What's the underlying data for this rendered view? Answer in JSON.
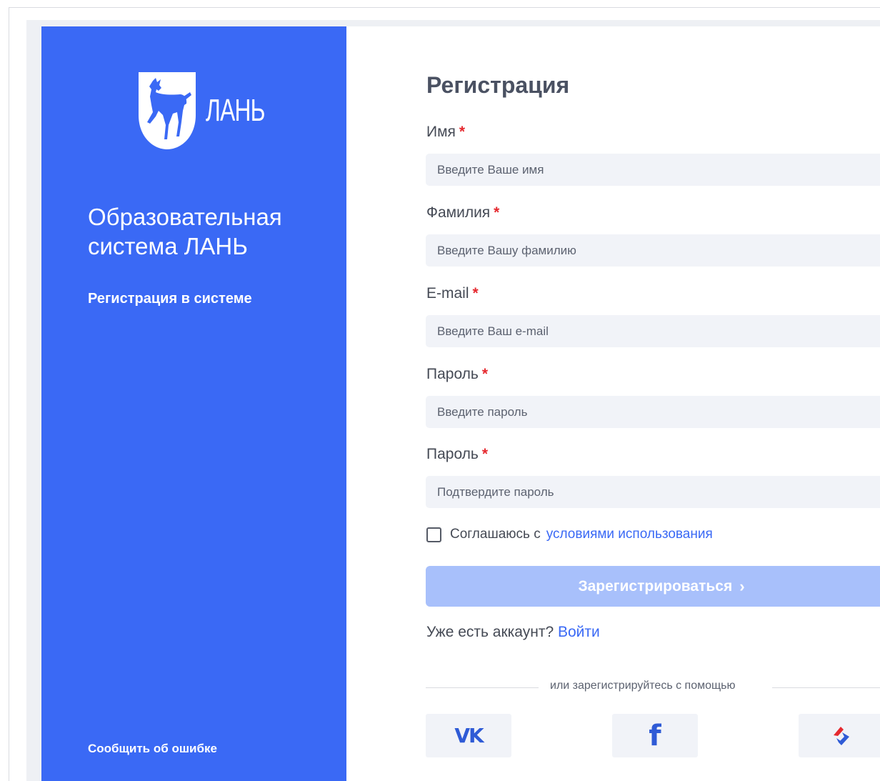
{
  "brand": {
    "logo_text": "ЛАНЬ",
    "title": "Образовательная система ЛАНЬ",
    "subtitle": "Регистрация в системе",
    "report_link": "Сообщить об ошибке",
    "colors": {
      "primary": "#3a69f5",
      "button_disabled": "#a8c0fb",
      "required": "#e5292f",
      "input_bg": "#f1f3f8"
    },
    "logo_icon": "deer-shield-icon"
  },
  "form": {
    "title": "Регистрация",
    "fields": [
      {
        "label": "Имя",
        "required_mark": "*",
        "placeholder": "Введите Ваше имя",
        "value": ""
      },
      {
        "label": "Фамилия",
        "required_mark": "*",
        "placeholder": "Введите Вашу фамилию",
        "value": ""
      },
      {
        "label": "E-mail",
        "required_mark": "*",
        "placeholder": "Введите Ваш e-mail",
        "value": ""
      },
      {
        "label": "Пароль",
        "required_mark": "*",
        "placeholder": "Введите пароль",
        "value": ""
      },
      {
        "label": "Пароль",
        "required_mark": "*",
        "placeholder": "Подтвердите пароль",
        "value": ""
      }
    ],
    "agree_text": "Соглашаюсь с",
    "terms_link": "условиями использования",
    "agree_checked": false,
    "submit_label": "Зарегистрироваться",
    "submit_chevron": "›",
    "have_account_text": "Уже есть аккаунт?",
    "login_link": "Войти",
    "social_divider_text": "или зарегистрируйтесь с помощью",
    "social": [
      {
        "name": "vk",
        "glyph": "VK",
        "icon": "vk-icon"
      },
      {
        "name": "facebook",
        "glyph": "f",
        "icon": "facebook-icon"
      },
      {
        "name": "gosuslugi",
        "icon": "gosuslugi-icon"
      }
    ]
  }
}
